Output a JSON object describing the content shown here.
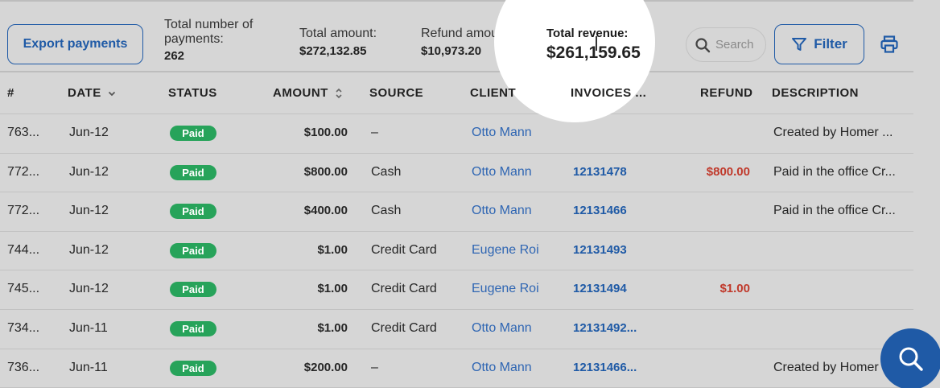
{
  "toolbar": {
    "export_label": "Export payments",
    "filter_label": "Filter",
    "search_placeholder": "Search"
  },
  "summary": {
    "count_label": "Total number of payments:",
    "count_value": "262",
    "amount_label": "Total amount:",
    "amount_value": "$272,132.85",
    "refund_label": "Refund amount:",
    "refund_value": "$10,973.20",
    "revenue_label": "Total revenue:",
    "revenue_value": "$261,159.65"
  },
  "table": {
    "columns": {
      "id": "#",
      "date": "DATE",
      "status": "STATUS",
      "amount": "AMOUNT",
      "source": "SOURCE",
      "client": "CLIENT",
      "invoices": "INVOICES ...",
      "refund": "REFUND",
      "description": "DESCRIPTION"
    },
    "rows": [
      {
        "id": "763...",
        "date": "Jun-12",
        "status": "Paid",
        "amount": "$100.00",
        "source": "–",
        "client": "Otto Mann",
        "invoice": "",
        "refund": "",
        "description": "Created by Homer ..."
      },
      {
        "id": "772...",
        "date": "Jun-12",
        "status": "Paid",
        "amount": "$800.00",
        "source": "Cash",
        "client": "Otto Mann",
        "invoice": "12131478",
        "refund": "$800.00",
        "description": "Paid in the office Cr..."
      },
      {
        "id": "772...",
        "date": "Jun-12",
        "status": "Paid",
        "amount": "$400.00",
        "source": "Cash",
        "client": "Otto Mann",
        "invoice": "12131466",
        "refund": "",
        "description": "Paid in the office Cr..."
      },
      {
        "id": "744...",
        "date": "Jun-12",
        "status": "Paid",
        "amount": "$1.00",
        "source": "Credit Card",
        "client": "Eugene Roi",
        "invoice": "12131493",
        "refund": "",
        "description": ""
      },
      {
        "id": "745...",
        "date": "Jun-12",
        "status": "Paid",
        "amount": "$1.00",
        "source": "Credit Card",
        "client": "Eugene Roi",
        "invoice": "12131494",
        "refund": "$1.00",
        "description": ""
      },
      {
        "id": "734...",
        "date": "Jun-11",
        "status": "Paid",
        "amount": "$1.00",
        "source": "Credit Card",
        "client": "Otto Mann",
        "invoice": "12131492...",
        "refund": "",
        "description": ""
      },
      {
        "id": "736...",
        "date": "Jun-11",
        "status": "Paid",
        "amount": "$200.00",
        "source": "–",
        "client": "Otto Mann",
        "invoice": "12131466...",
        "refund": "",
        "description": "Created by Homer"
      }
    ]
  },
  "colors": {
    "accent": "#1f5aa6",
    "paid_badge": "#27a35a",
    "refund_text": "#c0392b",
    "client_link": "#2f66b3"
  },
  "icons": {
    "search": "search-icon",
    "filter": "filter-icon",
    "print": "printer-icon",
    "fab": "search-icon",
    "date_sort": "chevron-down-icon",
    "amount_sort": "sort-icon"
  }
}
